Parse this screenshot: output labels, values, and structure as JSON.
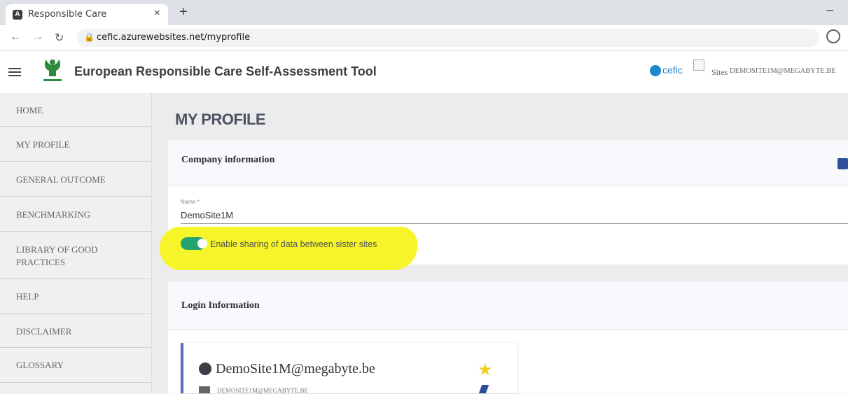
{
  "browser": {
    "tab_title": "Responsible Care",
    "tab_favicon": "A",
    "close_glyph": "×",
    "newtab_glyph": "+",
    "minimize_glyph": "–",
    "url": "cefic.azurewebsites.net/myprofile"
  },
  "header": {
    "title": "European Responsible Care Self-Assessment Tool",
    "cefic_label": "cefic",
    "sites_label": "Sites",
    "user_email": "DEMOSITE1M@MEGABYTE.BE"
  },
  "sidebar": {
    "items": [
      {
        "label": "HOME"
      },
      {
        "label": "MY PROFILE"
      },
      {
        "label": "GENERAL OUTCOME"
      },
      {
        "label": "BENCHMARKING"
      },
      {
        "label": "LIBRARY OF GOOD",
        "label2": "PRACTICES"
      },
      {
        "label": "HELP"
      },
      {
        "label": "DISCLAIMER"
      },
      {
        "label": "GLOSSARY"
      }
    ]
  },
  "main": {
    "page_title": "MY PROFILE",
    "company": {
      "title": "Company information",
      "name_label": "Name *",
      "name_value": "DemoSite1M",
      "sharing_label": "Enable sharing of data between sister sites",
      "sharing_enabled": true
    },
    "login": {
      "title": "Login Information",
      "account_name": "DemoSite1M@megabyte.be",
      "account_email": "DEMOSITE1M@MEGABYTE.BE"
    }
  },
  "colors": {
    "toggle_on": "#24a36c",
    "highlight": "#f5f52a",
    "accent": "#2f4f9a",
    "star": "#f0d020"
  }
}
